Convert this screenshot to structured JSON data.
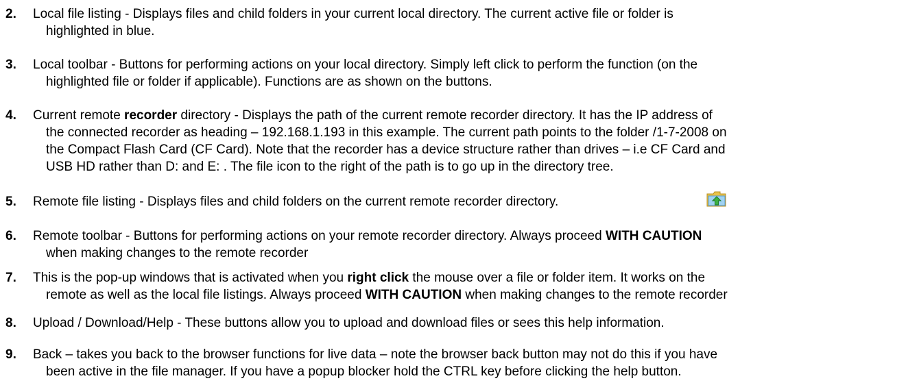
{
  "items": [
    {
      "number": "2.",
      "lines": [
        [
          "Local file listing - Displays files and child folders in your current local directory. The current active file or folder is"
        ],
        [
          "highlighted in blue."
        ]
      ]
    },
    {
      "number": "3.",
      "lines": [
        [
          "Local toolbar - Buttons for performing actions on your local directory. Simply left click to perform the function (on the"
        ],
        [
          "highlighted file or folder if applicable). Functions are as shown on the buttons."
        ]
      ]
    },
    {
      "number": "4.",
      "lines": [
        [
          "Current remote ",
          "recorder",
          " directory - Displays the path of the current remote recorder directory. It has the IP address of"
        ],
        [
          "the connected recorder as heading – 192.168.1.193 in this example. The current path points to the folder  /1-7-2008  on"
        ],
        [
          "the Compact Flash Card (CF Card). Note that the recorder has a device structure rather than drives – i.e  CF Card and"
        ],
        [
          "USB HD rather than D: and E: . The file icon to the right of the path is to go up in the directory tree."
        ]
      ]
    },
    {
      "number": "5.",
      "lines": [
        [
          "Remote file listing - Displays files and child folders on the current remote recorder directory."
        ]
      ]
    },
    {
      "number": "6.",
      "lines": [
        [
          "Remote toolbar - Buttons for performing actions on your remote recorder directory. Always proceed ",
          "WITH CAUTION"
        ],
        [
          "when making changes to the remote recorder"
        ]
      ]
    },
    {
      "number": "7.",
      "lines": [
        [
          "This is the pop-up windows that is activated when you ",
          "right click",
          " the mouse over a file or folder item. It works on the"
        ],
        [
          "remote as well as the local file listings. Always proceed ",
          "WITH CAUTION",
          " when making changes to the remote recorder"
        ]
      ]
    },
    {
      "number": "8.",
      "lines": [
        [
          "Upload / Download/Help - These buttons allow you to upload and download files or sees this help information."
        ]
      ]
    },
    {
      "number": "9.",
      "lines": [
        [
          "Back – takes you back to the browser functions for live data – note the browser back button may not do this if you have"
        ],
        [
          "been active in the file manager. If you have a popup blocker hold the CTRL key before clicking the help button."
        ]
      ]
    }
  ],
  "icons": {
    "folder_up": "folder-up-icon"
  }
}
